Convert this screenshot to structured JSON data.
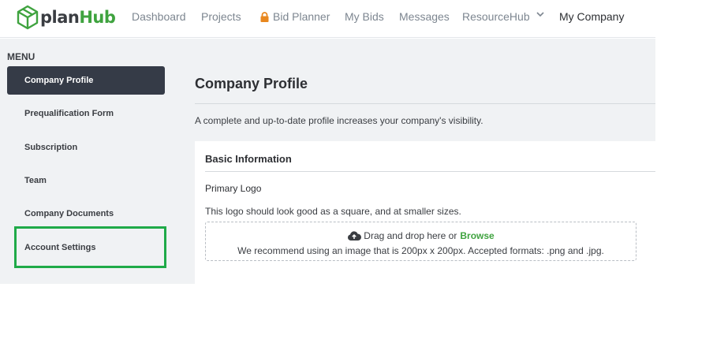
{
  "brand": {
    "name_part1": "plan",
    "name_part2": "Hub",
    "color_dark": "#3a3d42",
    "color_green": "#3fa33f"
  },
  "nav": {
    "dashboard": "Dashboard",
    "projects": "Projects",
    "bid_planner": "Bid Planner",
    "my_bids": "My Bids",
    "messages": "Messages",
    "resourcehub": "ResourceHub",
    "my_company": "My Company"
  },
  "sidebar": {
    "menu_label": "MENU",
    "items": [
      {
        "label": "Company Profile",
        "active": true
      },
      {
        "label": "Prequalification Form"
      },
      {
        "label": "Subscription"
      },
      {
        "label": "Team"
      },
      {
        "label": "Company Documents"
      },
      {
        "label": "Account Settings",
        "highlighted": true
      }
    ],
    "active_color": "#353b47",
    "highlight_color": "#1faa48"
  },
  "main": {
    "title": "Company Profile",
    "description": "A complete and up-to-date profile increases your company's visibility.",
    "card": {
      "title": "Basic Information",
      "logo_label": "Primary Logo",
      "logo_hint": "This logo should look good as a square, and at smaller sizes.",
      "dropzone": {
        "text": "Drag and drop here or",
        "browse": "Browse",
        "recommendation": "We recommend using an image that is 200px x 200px. Accepted formats: .png and .jpg."
      }
    }
  },
  "icons": {
    "logo": "planhub-cube-icon",
    "lock": "lock-icon",
    "chevron": "chevron-down-icon",
    "upload": "cloud-upload-icon"
  }
}
